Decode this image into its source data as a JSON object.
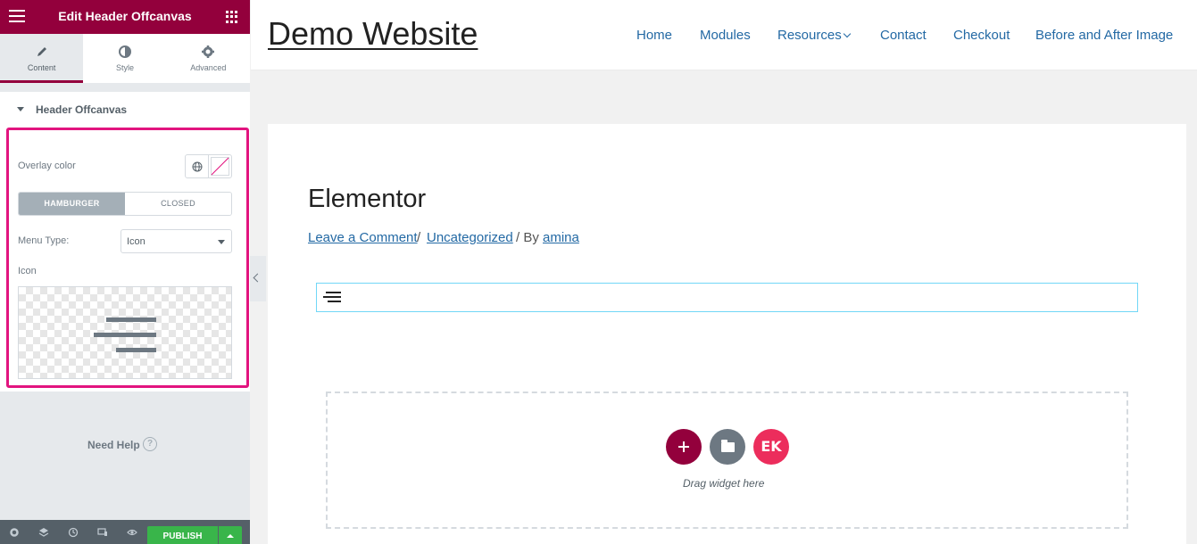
{
  "panel": {
    "header_title": "Edit Header Offcanvas",
    "tabs": [
      {
        "label": "Content",
        "icon": "pencil-icon",
        "active": true
      },
      {
        "label": "Style",
        "icon": "contrast-icon",
        "active": false
      },
      {
        "label": "Advanced",
        "icon": "gear-icon",
        "active": false
      }
    ],
    "section_title": "Header Offcanvas",
    "overlay_color_label": "Overlay color",
    "toggle": {
      "hamburger": "HAMBURGER",
      "closed": "CLOSED",
      "active": "HAMBURGER"
    },
    "menu_type_label": "Menu Type:",
    "menu_type_value": "Icon",
    "icon_label": "Icon",
    "need_help": "Need Help",
    "help_glyph": "?",
    "publish": "PUBLISH"
  },
  "colors": {
    "brand": "#93003c",
    "highlight": "#e2147f",
    "publish_green": "#39b54a",
    "link_blue": "#2369a4"
  },
  "site": {
    "title": "Demo Website",
    "nav": [
      "Home",
      "Modules",
      "Resources",
      "Contact",
      "Checkout",
      "Before and After Image"
    ],
    "post_title": "Elementor",
    "meta": {
      "comment_link": "Leave a Comment",
      "sep1": "/",
      "category_link": "Uncategorized",
      "sep2": "/ By",
      "author_link": "amina"
    },
    "drag_text": "Drag widget here",
    "ek_label": "EK"
  }
}
